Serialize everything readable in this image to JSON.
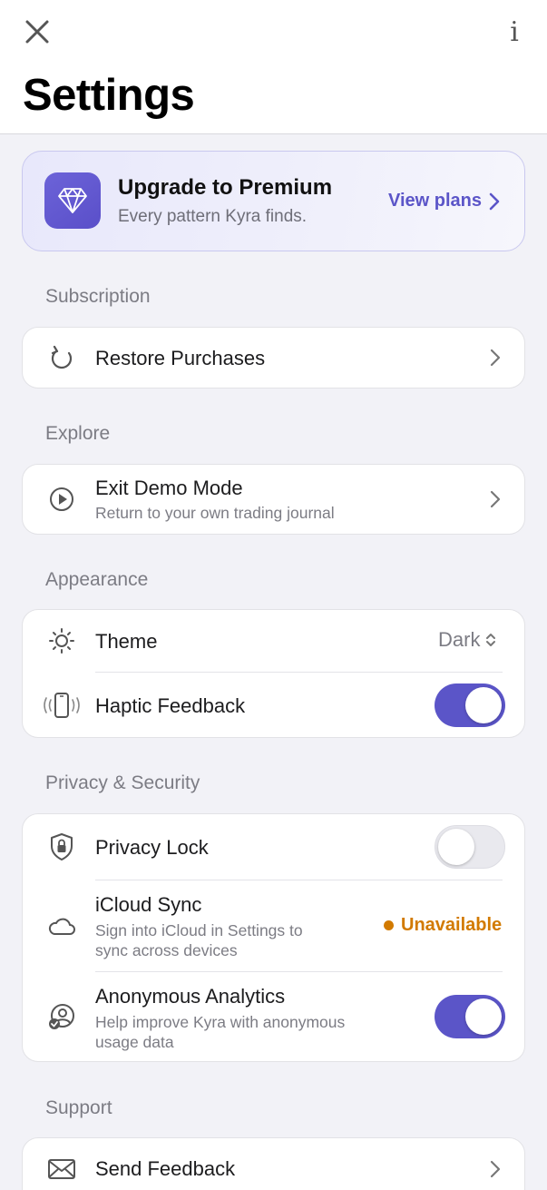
{
  "header": {
    "title": "Settings",
    "close_icon": "close-icon",
    "info_label": "i"
  },
  "premium": {
    "title": "Upgrade to Premium",
    "subtitle": "Every pattern Kyra finds.",
    "cta": "View plans",
    "icon": "diamond-icon",
    "accent": "#5b55c8"
  },
  "sections": {
    "subscription": {
      "label": "Subscription",
      "restore": {
        "title": "Restore Purchases",
        "icon": "restore-icon"
      }
    },
    "explore": {
      "label": "Explore",
      "demo": {
        "title": "Exit Demo Mode",
        "subtitle": "Return to your own trading journal",
        "icon": "play-circle-icon"
      }
    },
    "appearance": {
      "label": "Appearance",
      "theme": {
        "title": "Theme",
        "value": "Dark",
        "icon": "sun-icon"
      },
      "haptic": {
        "title": "Haptic Feedback",
        "enabled": true,
        "icon": "phone-vibrate-icon"
      }
    },
    "privacy": {
      "label": "Privacy & Security",
      "lock": {
        "title": "Privacy Lock",
        "enabled": false,
        "icon": "shield-lock-icon"
      },
      "icloud": {
        "title": "iCloud Sync",
        "subtitle_line1": "Sign into iCloud in Settings to",
        "subtitle_line2": "sync across devices",
        "status": "Unavailable",
        "status_color": "#d27a00",
        "icon": "cloud-icon"
      },
      "analytics": {
        "title": "Anonymous Analytics",
        "subtitle_line1": "Help improve Kyra with anonymous",
        "subtitle_line2": "usage data",
        "enabled": true,
        "icon": "user-check-icon"
      }
    },
    "support": {
      "label": "Support",
      "feedback": {
        "title": "Send Feedback",
        "icon": "envelope-icon"
      }
    }
  }
}
